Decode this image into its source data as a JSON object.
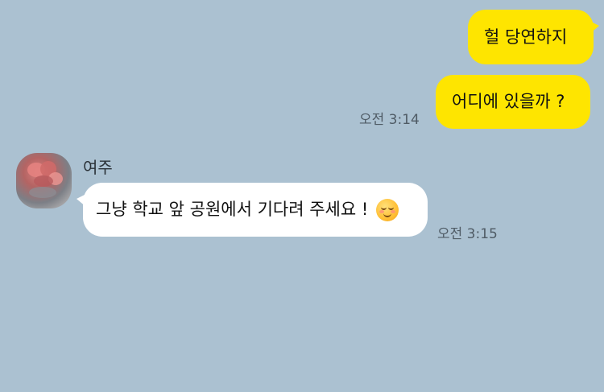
{
  "chat": {
    "messages": [
      {
        "sender": "me",
        "text": "헐 당연하지"
      },
      {
        "sender": "me",
        "text": "어디에 있을까 ?",
        "time": "오전 3:14"
      },
      {
        "sender": "여주",
        "text": "그냥 학교 앞 공원에서 기다려 주세요 !",
        "emoji": "smiling-face-icon",
        "time": "오전 3:15"
      }
    ]
  },
  "colors": {
    "background": "#abc1d1",
    "my_bubble": "#fee500",
    "their_bubble": "#ffffff"
  }
}
